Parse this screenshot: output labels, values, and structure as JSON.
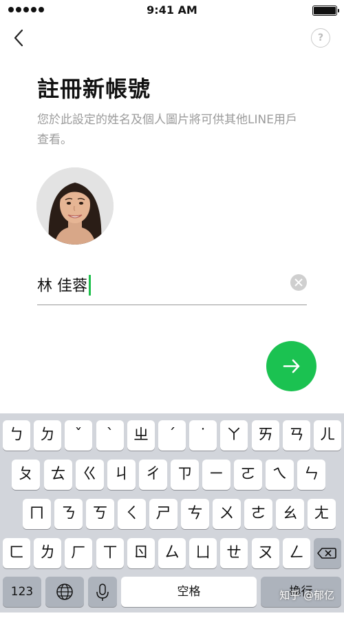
{
  "status_bar": {
    "time": "9:41 AM",
    "signal_dots": 5,
    "icons": [
      "signal-dots-icon",
      "battery-icon"
    ]
  },
  "nav": {
    "back_icon": "chevron-left-icon",
    "help_label": "?"
  },
  "header": {
    "title": "註冊新帳號",
    "subtitle": "您於此設定的姓名及個人圖片將可供其他LINE用戶查看。"
  },
  "profile": {
    "avatar_icon": "profile-photo"
  },
  "name_field": {
    "value": "林 佳蓉",
    "clear_icon": "clear-icon"
  },
  "next_button": {
    "icon": "arrow-right-icon",
    "color": "#1bc251"
  },
  "keyboard": {
    "rows": [
      [
        "ㄅ",
        "ㄉ",
        "ˇ",
        "ˋ",
        "ㄓ",
        "ˊ",
        "˙",
        "ㄚ",
        "ㄞ",
        "ㄢ",
        "ㄦ"
      ],
      [
        "ㄆ",
        "ㄊ",
        "ㄍ",
        "ㄐ",
        "ㄔ",
        "ㄗ",
        "ㄧ",
        "ㄛ",
        "ㄟ",
        "ㄣ"
      ],
      [
        "ㄇ",
        "ㄋ",
        "ㄎ",
        "ㄑ",
        "ㄕ",
        "ㄘ",
        "ㄨ",
        "ㄜ",
        "ㄠ",
        "ㄤ"
      ],
      [
        "ㄈ",
        "ㄌ",
        "ㄏ",
        "ㄒ",
        "ㄖ",
        "ㄙ",
        "ㄩ",
        "ㄝ",
        "ㄡ",
        "ㄥ"
      ]
    ],
    "backspace_icon": "backspace-icon",
    "numbers_label": "123",
    "globe_icon": "globe-icon",
    "mic_icon": "microphone-icon",
    "space_label": "空格",
    "return_label": "換行"
  },
  "watermark": "知乎 @郁亿",
  "colors": {
    "accent": "#1bc251",
    "caret": "#1dc04b",
    "keyboard_bg": "#d2d5db",
    "subtitle": "#9b9b9b"
  }
}
